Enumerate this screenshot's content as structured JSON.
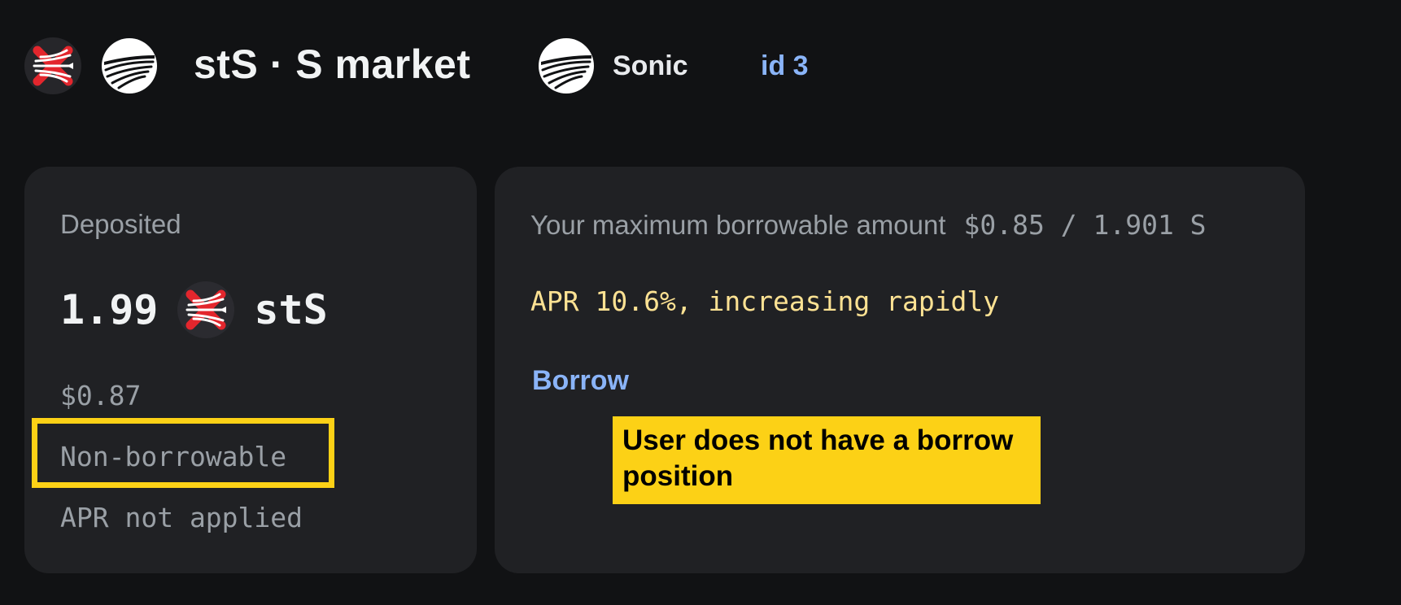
{
  "header": {
    "collateral_icon": "sts-token-icon",
    "loan_icon": "sonic-token-icon",
    "title": "stS · S market",
    "network_icon": "sonic-network-icon",
    "network_name": "Sonic",
    "market_id": "id 3"
  },
  "deposit_card": {
    "label": "Deposited",
    "amount": "1.99",
    "token_icon": "sts-token-icon",
    "symbol": "stS",
    "usd_value": "$0.87",
    "borrow_status": "Non-borrowable",
    "apr_status": "APR not applied"
  },
  "borrow_card": {
    "max_label": "Your maximum borrowable amount",
    "max_value": "$0.85 / 1.901 S",
    "apr_text": "APR 10.6%, increasing rapidly",
    "borrow_link": "Borrow"
  },
  "annotation": {
    "note": "User does not have a borrow position",
    "highlight_color": "#fcd116"
  },
  "colors": {
    "background": "#111214",
    "card": "#202124",
    "link": "#8ab4f8",
    "apr_warning": "#fde293",
    "muted": "#9aa0a6"
  }
}
